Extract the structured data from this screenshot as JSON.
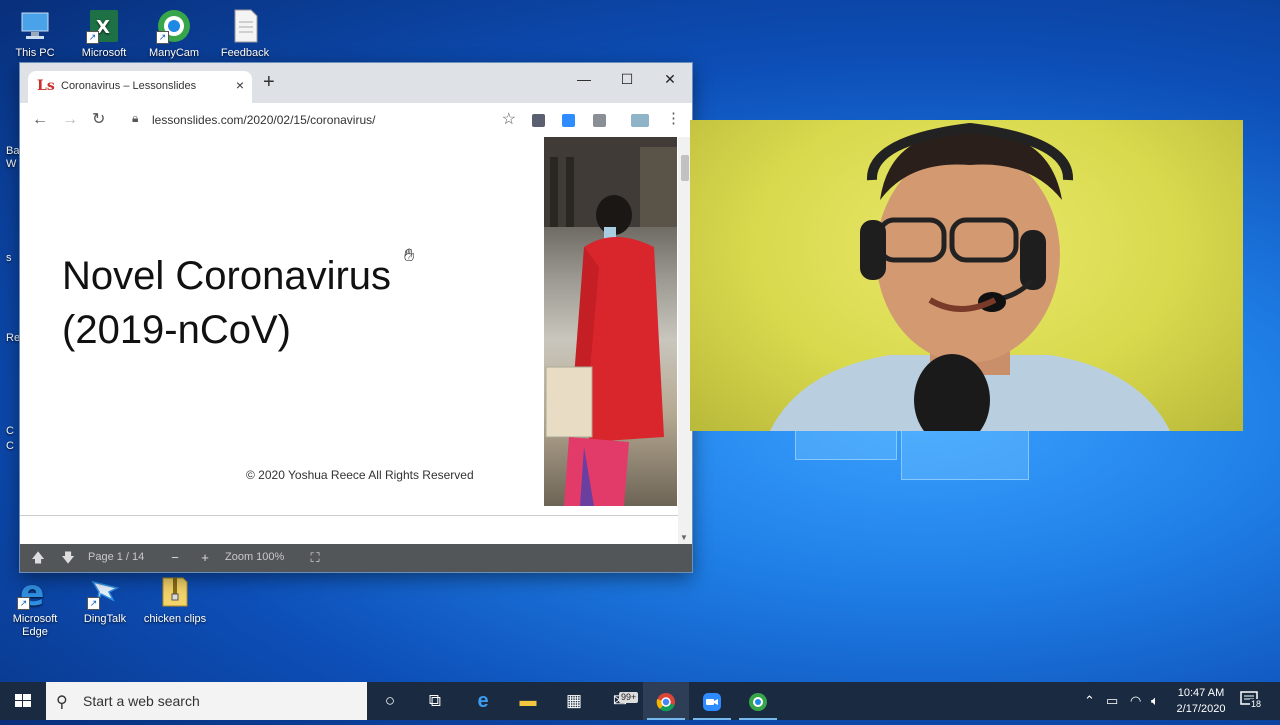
{
  "desktop": {
    "icons_top": [
      {
        "label": "This PC"
      },
      {
        "label": "Microsoft"
      },
      {
        "label": "ManyCam"
      },
      {
        "label": "Feedback"
      }
    ],
    "icons_bottom": [
      {
        "label": "Microsoft Edge"
      },
      {
        "label": "DingTalk"
      },
      {
        "label": "chicken clips"
      }
    ],
    "side_fragments": [
      "Ba",
      "W",
      "s",
      "Re",
      "C",
      "C"
    ]
  },
  "browser": {
    "tab": {
      "favicon": "Ls",
      "title": "Coronavirus – Lessonslides",
      "close": "×"
    },
    "new_tab": "+",
    "window_controls": {
      "minimize": "—",
      "maximize": "☐",
      "close": "✕"
    },
    "url": "lessonslides.com/2020/02/15/coronavirus/",
    "slide": {
      "title_line1": "Novel Coronavirus",
      "title_line2": "(2019-nCoV)",
      "copyright": "© 2020 Yoshua Reece All Rights Reserved"
    },
    "pdf_toolbar": {
      "page": "Page 1 / 14",
      "zoom": "Zoom 100%"
    }
  },
  "taskbar": {
    "search_placeholder": "Start a web search",
    "store_badge": "99+",
    "clock_time": "10:47 AM",
    "clock_date": "2/17/2020",
    "notification_count": "18"
  },
  "colors": {
    "accent": "#1f7fe6",
    "taskbar": "#1a2a40",
    "favicon": "#c9302c",
    "webcam_bg": "#d9d94e"
  }
}
